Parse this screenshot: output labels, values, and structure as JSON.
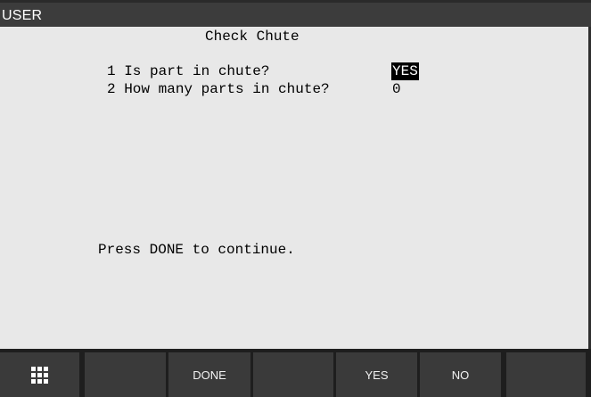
{
  "window": {
    "title": "USER"
  },
  "screen": {
    "title": "Check Chute",
    "prompts": [
      {
        "label": "1 Is part in chute?",
        "value": "YES",
        "selected": true
      },
      {
        "label": "2 How many parts in chute?",
        "value": "0",
        "selected": false
      }
    ],
    "message": "Press DONE to continue."
  },
  "softkeys": {
    "menu_icon": "grid-menu-icon",
    "f1": "",
    "f2": "DONE",
    "f3": "",
    "f4": "YES",
    "f5": "NO",
    "f6": ""
  },
  "colors": {
    "screen_background": "#e8e8e8",
    "titlebar_background": "#3c3c3c",
    "softkey_background": "#3a3a3a",
    "highlight_background": "#000000",
    "highlight_text": "#ffffff"
  }
}
